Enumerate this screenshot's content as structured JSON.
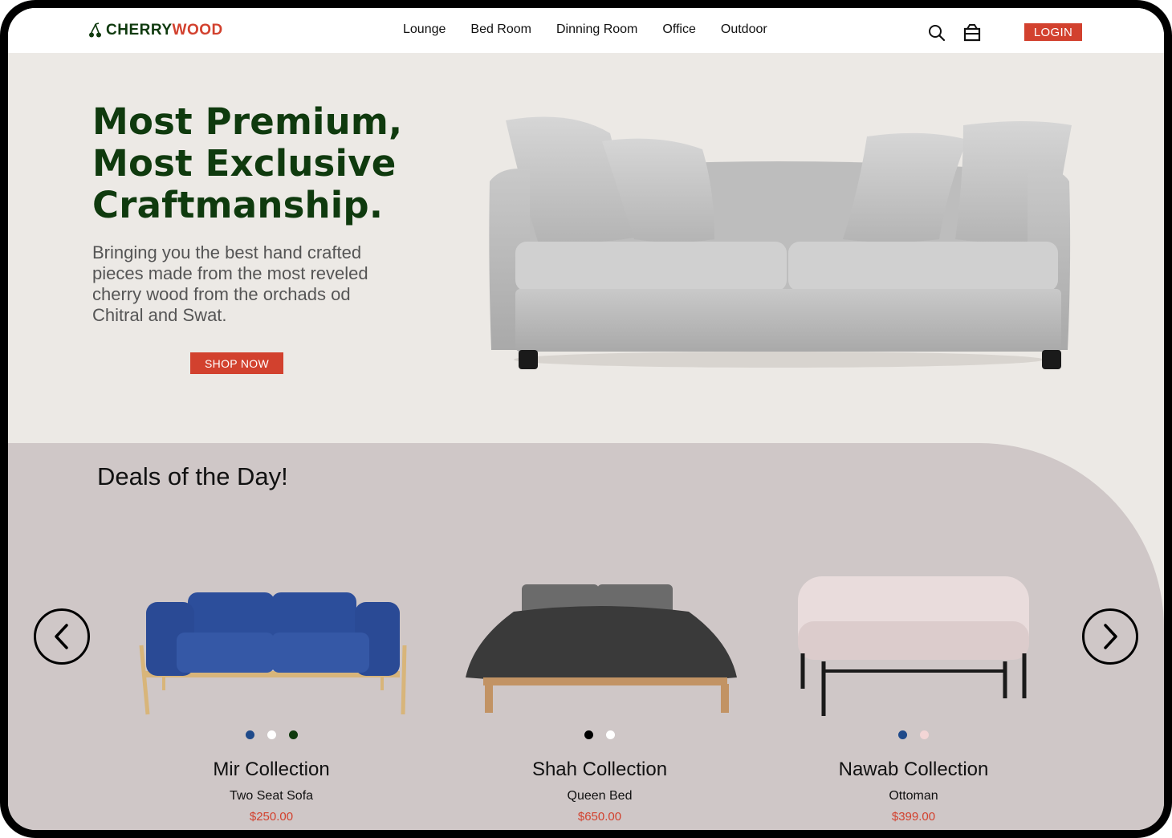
{
  "brand": {
    "name_part1": "CHERRY",
    "name_part2": "WOOD"
  },
  "nav": {
    "items": [
      "Lounge",
      "Bed Room",
      "Dinning Room",
      "Office",
      "Outdoor"
    ]
  },
  "header": {
    "login_label": "LOGIN",
    "search_icon": "search-icon",
    "cart_icon": "shopping-bag-icon"
  },
  "hero": {
    "title_lines": [
      "Most Premium,",
      "Most Exclusive",
      "Craftmanship."
    ],
    "subtitle": "Bringing you the best hand crafted pieces made from the most reveled cherry wood from the orchads od Chitral and Swat.",
    "cta_label": "SHOP NOW"
  },
  "deals": {
    "title": "Deals of the Day!",
    "prev_icon": "chevron-left-icon",
    "next_icon": "chevron-right-icon",
    "products": [
      {
        "name": "Mir Collection",
        "type": "Two Seat Sofa",
        "price": "$250.00",
        "colors": [
          "#1f4a8a",
          "#ffffff",
          "#0f3a0e"
        ]
      },
      {
        "name": "Shah Collection",
        "type": "Queen Bed",
        "price": "$650.00",
        "colors": [
          "#000000",
          "#ffffff"
        ]
      },
      {
        "name": "Nawab Collection",
        "type": "Ottoman",
        "price": "$399.00",
        "colors": [
          "#1f4a8a",
          "#f3d6d6"
        ]
      }
    ]
  },
  "colors": {
    "accent": "#d2412e",
    "brand_green": "#0f3a0e",
    "hero_bg": "#ece9e5",
    "deals_bg": "#cfc7c7"
  }
}
